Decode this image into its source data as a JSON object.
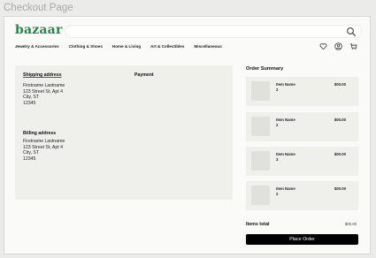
{
  "page_caption": "Checkout Page",
  "brand": {
    "name": "bazaar",
    "color": "#1f8a46"
  },
  "search": {
    "icon": "search-icon"
  },
  "nav": {
    "items": [
      {
        "label": "Jewelry & Accessories"
      },
      {
        "label": "Clothing & Shoes"
      },
      {
        "label": "Home & Living"
      },
      {
        "label": "Art & Collectibles"
      },
      {
        "label": "Miscellaneous"
      }
    ],
    "icons": [
      "heart-icon",
      "user-icon",
      "cart-icon"
    ]
  },
  "checkout": {
    "shipping": {
      "title": "Shipping address",
      "name": "Firstname Lastname",
      "street": "123 Street St, Apt 4",
      "city": "City, ST",
      "zip": "12345"
    },
    "payment": {
      "title": "Payment"
    },
    "billing": {
      "title": "Billing address",
      "name": "Firstname Lastname",
      "street": "123 Street St, Apt 4",
      "city": "City, ST",
      "zip": "12345"
    }
  },
  "summary": {
    "title": "Order Summary",
    "items": [
      {
        "name": "Item Name",
        "qty": "2",
        "price": "$00.00"
      },
      {
        "name": "Item Name",
        "qty": "2",
        "price": "$00.00"
      },
      {
        "name": "Item Name",
        "qty": "3",
        "price": "$00.00"
      },
      {
        "name": "Item Name",
        "qty": "2",
        "price": "$00.00"
      }
    ],
    "total_label": "Items total",
    "total_value": "$00.00",
    "place_order": "Place Order"
  },
  "colors": {
    "accent_underline": "#2659c9",
    "button": "#000000"
  }
}
